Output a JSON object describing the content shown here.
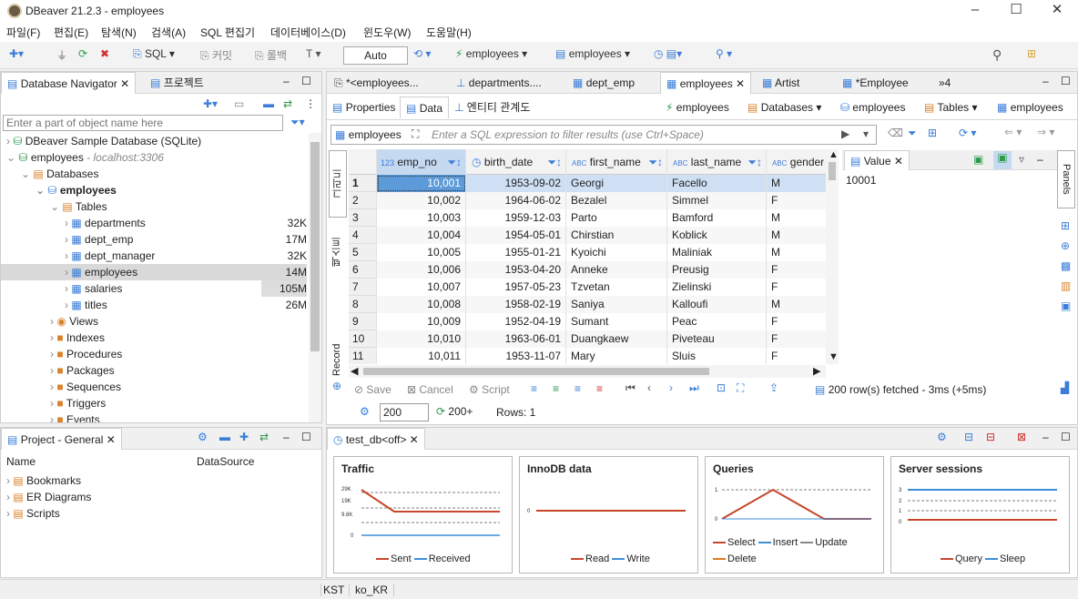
{
  "window": {
    "title": "DBeaver 21.2.3 - employees"
  },
  "menu": [
    "파일(F)",
    "편집(E)",
    "탐색(N)",
    "검색(A)",
    "SQL 편집기",
    "데이터베이스(D)",
    "윈도우(W)",
    "도움말(H)"
  ],
  "toolbar": {
    "sql": "SQL",
    "commit": "커밋",
    "rollback": "롤백",
    "mode": "Auto",
    "conn1": "employees",
    "conn2": "employees"
  },
  "navigator": {
    "tab1": "Database Navigator",
    "tab2": "프로젝트",
    "filter_placeholder": "Enter a part of object name here",
    "items": [
      {
        "label": "DBeaver Sample Database (SQLite)"
      },
      {
        "label": "employees",
        "sub": " - localhost:3306"
      },
      {
        "label": "Databases"
      },
      {
        "label": "employees"
      },
      {
        "label": "Tables"
      },
      {
        "label": "departments",
        "size": "32K"
      },
      {
        "label": "dept_emp",
        "size": "17M"
      },
      {
        "label": "dept_manager",
        "size": "32K"
      },
      {
        "label": "employees",
        "size": "14M"
      },
      {
        "label": "salaries",
        "size": "105M"
      },
      {
        "label": "titles",
        "size": "26M"
      },
      {
        "label": "Views"
      },
      {
        "label": "Indexes"
      },
      {
        "label": "Procedures"
      },
      {
        "label": "Packages"
      },
      {
        "label": "Sequences"
      },
      {
        "label": "Triggers"
      },
      {
        "label": "Events"
      }
    ]
  },
  "project": {
    "tab": "Project - General",
    "col_name": "Name",
    "col_ds": "DataSource",
    "items": [
      "Bookmarks",
      "ER Diagrams",
      "Scripts"
    ]
  },
  "editor_tabs": [
    "*<employees...",
    "departments....",
    "dept_emp",
    "employees",
    "Artist",
    "*Employee",
    "»4"
  ],
  "subtabs": {
    "properties": "Properties",
    "data": "Data",
    "er": "엔티티 관계도",
    "crumb1": "employees",
    "crumb2": "Databases",
    "crumb3": "employees",
    "crumb4": "Tables",
    "crumb5": "employees"
  },
  "filter": {
    "label": "employees",
    "placeholder": "Enter a SQL expression to filter results (use Ctrl+Space)"
  },
  "side_vtabs": {
    "grid": "그리드",
    "text": "텍스트",
    "record": "Record"
  },
  "grid": {
    "columns": [
      "emp_no",
      "birth_date",
      "first_name",
      "last_name",
      "gender"
    ],
    "rows": [
      [
        "1",
        "10,001",
        "1953-09-02",
        "Georgi",
        "Facello",
        "M"
      ],
      [
        "2",
        "10,002",
        "1964-06-02",
        "Bezalel",
        "Simmel",
        "F"
      ],
      [
        "3",
        "10,003",
        "1959-12-03",
        "Parto",
        "Bamford",
        "M"
      ],
      [
        "4",
        "10,004",
        "1954-05-01",
        "Chirstian",
        "Koblick",
        "M"
      ],
      [
        "5",
        "10,005",
        "1955-01-21",
        "Kyoichi",
        "Maliniak",
        "M"
      ],
      [
        "6",
        "10,006",
        "1953-04-20",
        "Anneke",
        "Preusig",
        "F"
      ],
      [
        "7",
        "10,007",
        "1957-05-23",
        "Tzvetan",
        "Zielinski",
        "F"
      ],
      [
        "8",
        "10,008",
        "1958-02-19",
        "Saniya",
        "Kalloufi",
        "M"
      ],
      [
        "9",
        "10,009",
        "1952-04-19",
        "Sumant",
        "Peac",
        "F"
      ],
      [
        "10",
        "10,010",
        "1963-06-01",
        "Duangkaew",
        "Piveteau",
        "F"
      ],
      [
        "11",
        "10,011",
        "1953-11-07",
        "Mary",
        "Sluis",
        "F"
      ]
    ]
  },
  "value_panel": {
    "title": "Value",
    "value": "10001",
    "panels_label": "Panels"
  },
  "actions": {
    "save": "Save",
    "cancel": "Cancel",
    "script": "Script",
    "status": "200 row(s) fetched - 3ms (+5ms)",
    "fetch_size": "200",
    "fetch_more": "200+",
    "rows": "Rows: 1"
  },
  "dashboard": {
    "tab": "test_db<off>",
    "charts": [
      {
        "title": "Traffic",
        "ticks": [
          "29K",
          "19K",
          "9.8K",
          "0"
        ],
        "legend": [
          "Sent",
          "Received"
        ]
      },
      {
        "title": "InnoDB data",
        "ticks": [
          "0"
        ],
        "legend": [
          "Read",
          "Write"
        ]
      },
      {
        "title": "Queries",
        "ticks": [
          "1",
          "0"
        ],
        "legend": [
          "Select",
          "Insert",
          "Update",
          "Delete"
        ]
      },
      {
        "title": "Server sessions",
        "ticks": [
          "3",
          "2",
          "1",
          "0"
        ],
        "legend": [
          "Query",
          "Sleep"
        ]
      }
    ]
  },
  "statusbar": {
    "tz": "KST",
    "locale": "ko_KR"
  },
  "colors": {
    "accent": "#3b7dd8",
    "selected_row": "#cfe0f5",
    "selected_cell": "#5d9ad9",
    "line_red": "#c8462a",
    "line_blue": "#3d8ed8"
  }
}
